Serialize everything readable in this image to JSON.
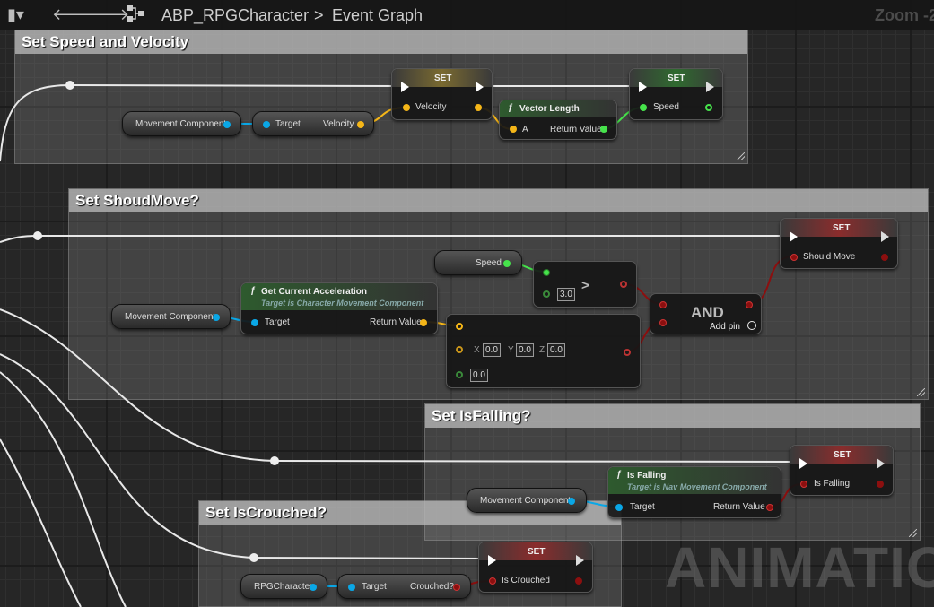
{
  "toolbar": {
    "bookmark_icon": "bookmark-icon",
    "back_icon": "arrow-left-icon",
    "forward_icon": "arrow-right-icon",
    "graph_icon": "blueprint-graph-icon",
    "crumb_asset": "ABP_RPGCharacter",
    "crumb_separator": ">",
    "crumb_graph": "Event Graph",
    "zoom": "Zoom -2"
  },
  "comments": {
    "speed_velocity": "Set Speed and Velocity",
    "should_move": "Set ShoudMove?",
    "is_falling": "Set IsFalling?",
    "is_crouched": "Set IsCrouched?"
  },
  "nodes": {
    "set1": {
      "title": "SET",
      "pin": "Velocity"
    },
    "set2": {
      "title": "SET",
      "pin": "Speed"
    },
    "movement1": "Movement Component",
    "velocity_getter": {
      "target": "Target",
      "out": "Velocity"
    },
    "vector_length": {
      "title": "Vector Length",
      "in": "A",
      "out": "Return Value"
    },
    "speed_getter": "Speed",
    "greater": {
      "op": ">",
      "value": "3.0"
    },
    "set_should": {
      "title": "SET",
      "pin": "Should Move"
    },
    "get_accel": {
      "title": "Get Current Acceleration",
      "subtitle": "Target is Character Movement Component",
      "in": "Target",
      "out": "Return Value"
    },
    "movement2": "Movement Component",
    "vec_break": {
      "x_label": "X",
      "x": "0.0",
      "y_label": "Y",
      "y": "0.0",
      "z_label": "Z",
      "z": "0.0",
      "tol": "0.0"
    },
    "and_node": {
      "title": "AND",
      "add_pin": "Add pin"
    },
    "set_falling": {
      "title": "SET",
      "pin": "Is Falling"
    },
    "is_falling": {
      "title": "Is Falling",
      "subtitle": "Target is Nav Movement Component",
      "in": "Target",
      "out": "Return Value"
    },
    "movement3": "Movement Component",
    "set_crouched": {
      "title": "SET",
      "pin": "Is Crouched"
    },
    "rpg_character": "RPGCharacter",
    "crouched_getter": {
      "target": "Target",
      "out": "Crouched?"
    }
  },
  "watermark": "ANIMATION",
  "colors": {
    "object_pin": "#0aa7e6",
    "vector_pin": "#f5b618",
    "float_pin": "#46e34b",
    "bool_pin": "#8c0f0f",
    "pure_func_header": "#2e5a2e",
    "set_header_red": "#8a2c2c",
    "set_header_green": "#2f6a2f",
    "set_header_gold": "#7a6a30"
  }
}
